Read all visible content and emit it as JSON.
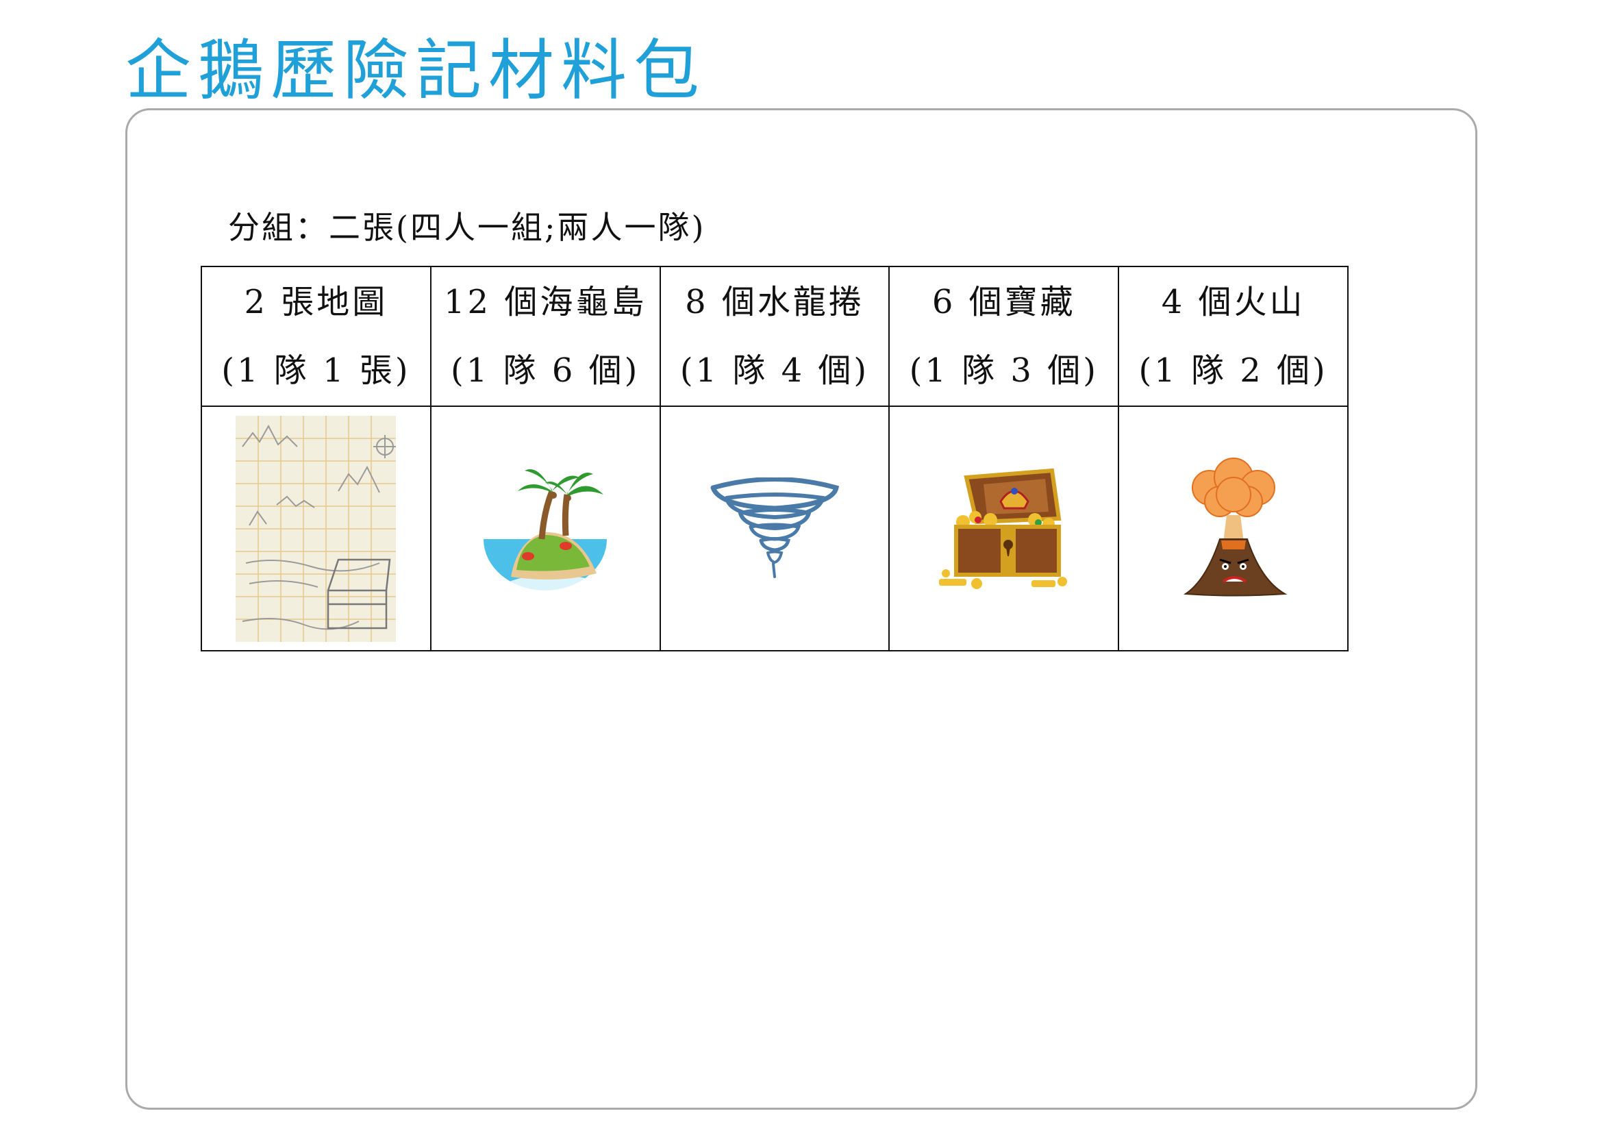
{
  "title": "企鵝歷險記材料包",
  "grouping": "分組：二張(四人一組;兩人一隊)",
  "items": [
    {
      "name": "2 張地圖",
      "per_team": "(1 隊 1 張)",
      "image": "treasure-map-icon"
    },
    {
      "name": "12 個海龜島",
      "per_team": "(1 隊 6 個)",
      "image": "island-icon"
    },
    {
      "name": "8 個水龍捲",
      "per_team": "(1 隊 4 個)",
      "image": "tornado-icon"
    },
    {
      "name": "6 個寶藏",
      "per_team": "(1 隊 3 個)",
      "image": "treasure-chest-icon"
    },
    {
      "name": "4 個火山",
      "per_team": "(1 隊 2 個)",
      "image": "volcano-icon"
    }
  ],
  "colors": {
    "title": "#1fa0d8",
    "frame_border": "#aaaaaa",
    "table_border": "#111111"
  }
}
